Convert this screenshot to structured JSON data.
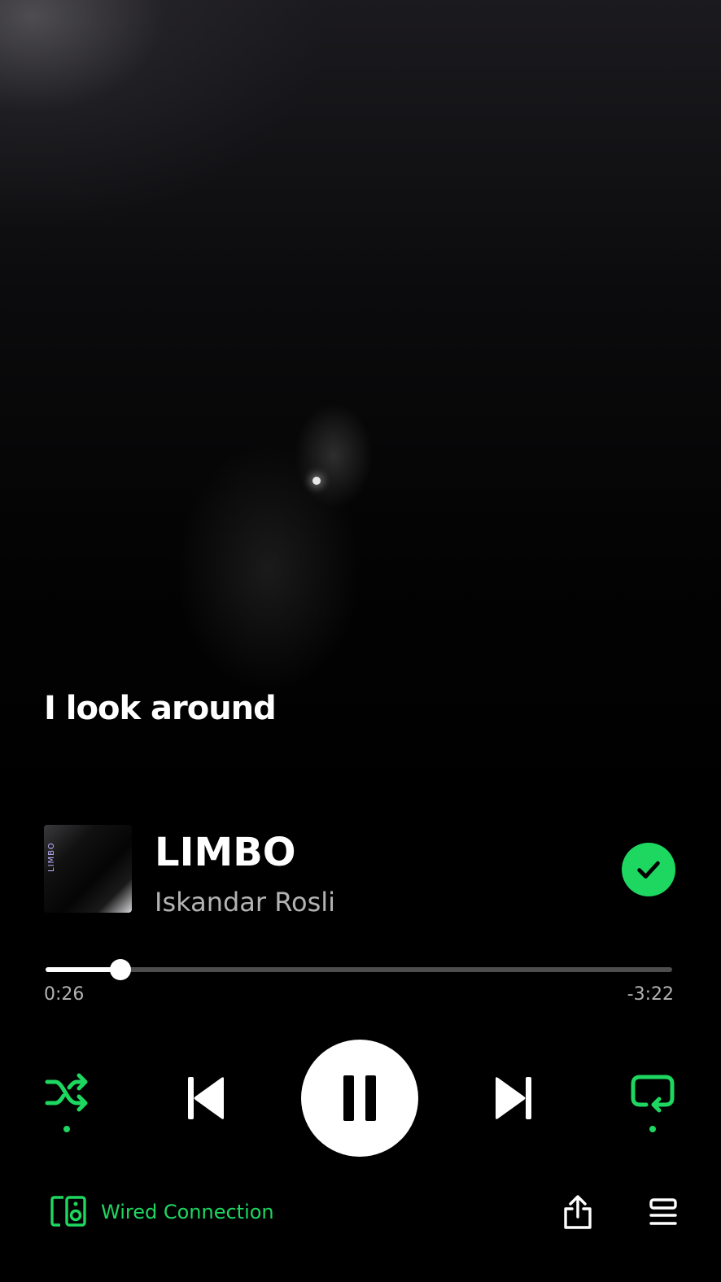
{
  "lyrics": {
    "current_line": "I look around"
  },
  "track": {
    "title": "LIMBO",
    "artist": "Iskandar Rosli",
    "album_art_text": "LIMBO",
    "saved": true
  },
  "playback": {
    "elapsed": "0:26",
    "remaining": "-3:22",
    "progress_fraction": 0.12,
    "state": "playing"
  },
  "controls": {
    "shuffle_icon": "shuffle-icon",
    "previous_icon": "skip-previous-icon",
    "pause_icon": "pause-icon",
    "next_icon": "skip-next-icon",
    "repeat_icon": "repeat-icon",
    "shuffle_active": true,
    "repeat_active": true
  },
  "device": {
    "label": "Wired Connection",
    "icon": "speaker-device-icon"
  },
  "footer": {
    "share_icon": "share-icon",
    "queue_icon": "queue-icon"
  },
  "colors": {
    "accent": "#1ed760",
    "background": "#000000",
    "text_primary": "#ffffff",
    "text_secondary": "#b3b3b3",
    "progress_track": "#4d4d4d"
  }
}
